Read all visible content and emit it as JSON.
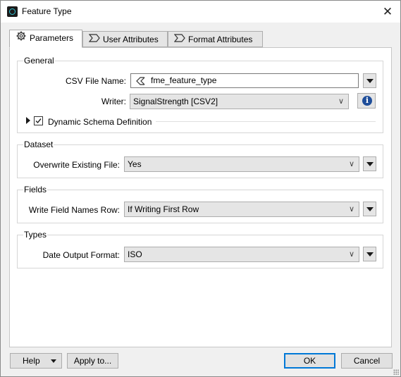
{
  "window": {
    "title": "Feature Type",
    "close_glyph": "✕"
  },
  "tabs": [
    {
      "label": "Parameters",
      "icon": "gear-icon",
      "active": true
    },
    {
      "label": "User Attributes",
      "icon": "sigma-icon",
      "active": false
    },
    {
      "label": "Format Attributes",
      "icon": "sigma-icon",
      "active": false
    }
  ],
  "general": {
    "group_label": "General",
    "csv_file_name_label": "CSV File Name:",
    "csv_file_name_value": "fme_feature_type",
    "writer_label": "Writer:",
    "writer_value": "SignalStrength [CSV2]",
    "dynamic_schema_label": "Dynamic Schema Definition",
    "dynamic_schema_checked": true
  },
  "dataset": {
    "group_label": "Dataset",
    "overwrite_label": "Overwrite Existing File:",
    "overwrite_value": "Yes"
  },
  "fields": {
    "group_label": "Fields",
    "write_field_names_label": "Write Field Names Row:",
    "write_field_names_value": "If Writing First Row"
  },
  "types": {
    "group_label": "Types",
    "date_output_label": "Date Output Format:",
    "date_output_value": "ISO"
  },
  "footer": {
    "help_label": "Help",
    "apply_label": "Apply to...",
    "ok_label": "OK",
    "cancel_label": "Cancel"
  },
  "colors": {
    "accent": "#0078d7",
    "info": "#1f4e9a",
    "app_icon_ring": "#2ec4d6"
  }
}
